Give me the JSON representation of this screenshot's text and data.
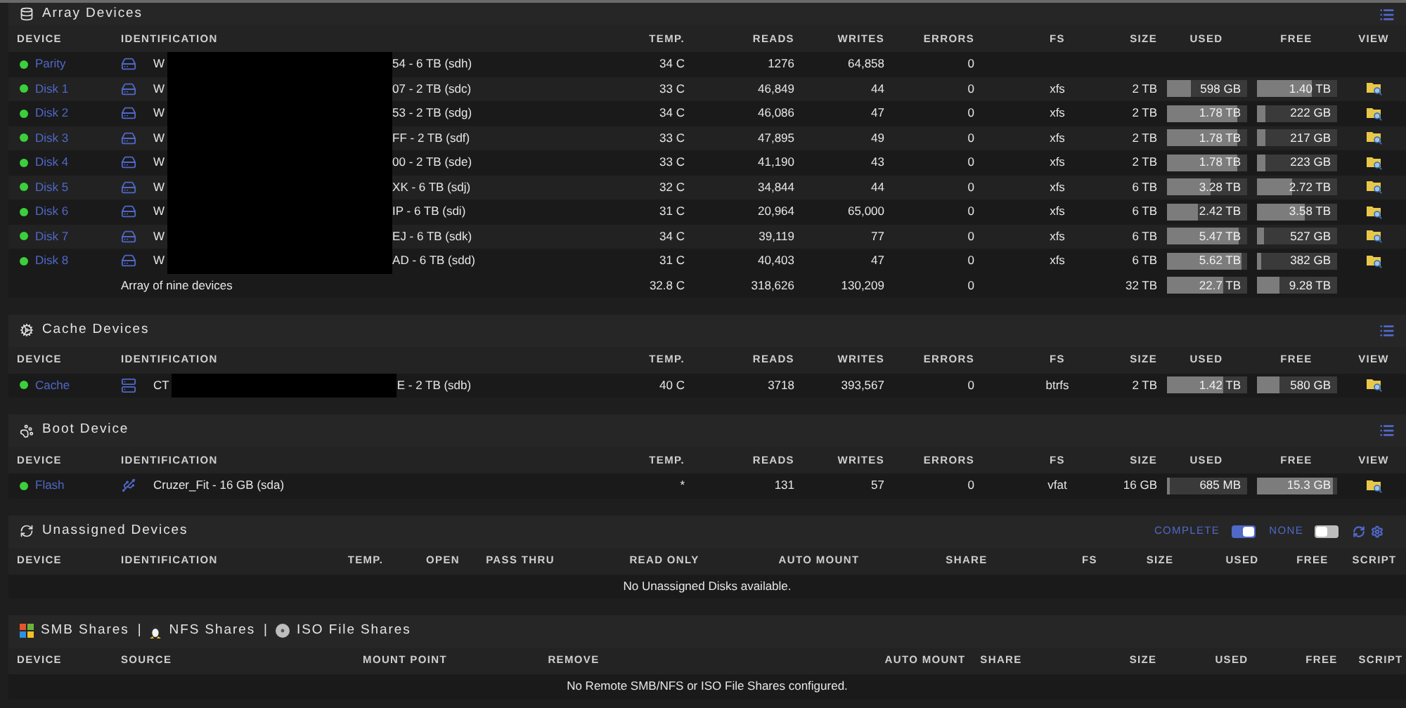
{
  "sections": [
    {
      "kind": "array",
      "title": "Array Devices",
      "columns": [
        "DEVICE",
        "IDENTIFICATION",
        "TEMP.",
        "READS",
        "WRITES",
        "ERRORS",
        "FS",
        "SIZE",
        "USED",
        "FREE",
        "VIEW"
      ],
      "rows": [
        {
          "device": "Parity",
          "id_start": "W",
          "redacted": true,
          "id_end": "54 - 6 TB (sdh)",
          "temp": "34 C",
          "reads": "1276",
          "writes": "64,858",
          "errors": "0"
        },
        {
          "device": "Disk 1",
          "id_start": "W",
          "redacted": true,
          "id_end": "07 - 2 TB (sdc)",
          "temp": "33 C",
          "reads": "46,849",
          "writes": "44",
          "errors": "0",
          "fs": "xfs",
          "size": "2 TB",
          "used": {
            "text": "598 GB",
            "level": 0.3
          },
          "free": {
            "text": "1.40 TB",
            "level": 0.7
          },
          "view": true
        },
        {
          "device": "Disk 2",
          "id_start": "W",
          "redacted": true,
          "id_end": "53 - 2 TB (sdg)",
          "temp": "34 C",
          "reads": "46,086",
          "writes": "47",
          "errors": "0",
          "fs": "xfs",
          "size": "2 TB",
          "used": {
            "text": "1.78 TB",
            "level": 0.89
          },
          "free": {
            "text": "222 GB",
            "level": 0.11
          },
          "view": true
        },
        {
          "device": "Disk 3",
          "id_start": "W",
          "redacted": true,
          "id_end": "FF - 2 TB (sdf)",
          "temp": "33 C",
          "reads": "47,895",
          "writes": "49",
          "errors": "0",
          "fs": "xfs",
          "size": "2 TB",
          "used": {
            "text": "1.78 TB",
            "level": 0.89
          },
          "free": {
            "text": "217 GB",
            "level": 0.11
          },
          "view": true
        },
        {
          "device": "Disk 4",
          "id_start": "W",
          "redacted": true,
          "id_end": "00 - 2 TB (sde)",
          "temp": "33 C",
          "reads": "41,190",
          "writes": "43",
          "errors": "0",
          "fs": "xfs",
          "size": "2 TB",
          "used": {
            "text": "1.78 TB",
            "level": 0.89
          },
          "free": {
            "text": "223 GB",
            "level": 0.11
          },
          "view": true
        },
        {
          "device": "Disk 5",
          "id_start": "W",
          "redacted": true,
          "id_end": "XK - 6 TB (sdj)",
          "temp": "32 C",
          "reads": "34,844",
          "writes": "44",
          "errors": "0",
          "fs": "xfs",
          "size": "6 TB",
          "used": {
            "text": "3.28 TB",
            "level": 0.55
          },
          "free": {
            "text": "2.72 TB",
            "level": 0.45
          },
          "view": true
        },
        {
          "device": "Disk 6",
          "id_start": "W",
          "redacted": true,
          "id_end": "IP - 6 TB (sdi)",
          "temp": "31 C",
          "reads": "20,964",
          "writes": "65,000",
          "errors": "0",
          "fs": "xfs",
          "size": "6 TB",
          "used": {
            "text": "2.42 TB",
            "level": 0.4
          },
          "free": {
            "text": "3.58 TB",
            "level": 0.6
          },
          "view": true
        },
        {
          "device": "Disk 7",
          "id_start": "W",
          "redacted": true,
          "id_end": "EJ - 6 TB (sdk)",
          "temp": "34 C",
          "reads": "39,119",
          "writes": "77",
          "errors": "0",
          "fs": "xfs",
          "size": "6 TB",
          "used": {
            "text": "5.47 TB",
            "level": 0.91
          },
          "free": {
            "text": "527 GB",
            "level": 0.09
          },
          "view": true
        },
        {
          "device": "Disk 8",
          "id_start": "W",
          "redacted": true,
          "id_end": "AD - 6 TB (sdd)",
          "temp": "31 C",
          "reads": "40,403",
          "writes": "47",
          "errors": "0",
          "fs": "xfs",
          "size": "6 TB",
          "used": {
            "text": "5.62 TB",
            "level": 0.94
          },
          "free": {
            "text": "382 GB",
            "level": 0.06
          },
          "view": true
        }
      ],
      "total": {
        "label": "Array of nine devices",
        "temp": "32.8 C",
        "reads": "318,626",
        "writes": "130,209",
        "errors": "0",
        "size": "32 TB",
        "used": {
          "text": "22.7 TB",
          "level": 0.71
        },
        "free": {
          "text": "9.28 TB",
          "level": 0.29
        }
      }
    },
    {
      "kind": "cache",
      "title": "Cache Devices",
      "columns": [
        "DEVICE",
        "IDENTIFICATION",
        "TEMP.",
        "READS",
        "WRITES",
        "ERRORS",
        "FS",
        "SIZE",
        "USED",
        "FREE",
        "VIEW"
      ],
      "rows": [
        {
          "device": "Cache",
          "id_start": "CT",
          "redacted": true,
          "id_end": "E - 2 TB (sdb)",
          "temp": "40 C",
          "reads": "3718",
          "writes": "393,567",
          "errors": "0",
          "fs": "btrfs",
          "size": "2 TB",
          "used": {
            "text": "1.42 TB",
            "level": 0.71
          },
          "free": {
            "text": "580 GB",
            "level": 0.29
          },
          "view": true
        }
      ]
    },
    {
      "kind": "boot",
      "title": "Boot Device",
      "columns": [
        "DEVICE",
        "IDENTIFICATION",
        "TEMP.",
        "READS",
        "WRITES",
        "ERRORS",
        "FS",
        "SIZE",
        "USED",
        "FREE",
        "VIEW"
      ],
      "rows": [
        {
          "device": "Flash",
          "id_start": "Cruzer_Fit",
          "redacted": false,
          "id_end": " - 16 GB (sda)",
          "temp": "*",
          "reads": "131",
          "writes": "57",
          "errors": "0",
          "fs": "vfat",
          "size": "16 GB",
          "used": {
            "text": "685 MB",
            "level": 0.04
          },
          "free": {
            "text": "15.3 GB",
            "level": 0.96
          },
          "view": true
        }
      ]
    },
    {
      "kind": "unassigned",
      "title": "Unassigned Devices",
      "toggles": [
        {
          "label": "COMPLETE",
          "on": true
        },
        {
          "label": "NONE",
          "on": false
        }
      ],
      "columns": [
        "DEVICE",
        "IDENTIFICATION",
        "TEMP.",
        "OPEN",
        "PASS THRU",
        "READ ONLY",
        "AUTO MOUNT",
        "SHARE",
        "FS",
        "SIZE",
        "USED",
        "FREE",
        "SCRIPT"
      ],
      "message": "No Unassigned Disks available."
    },
    {
      "kind": "shares",
      "tabs": [
        {
          "label": "SMB Shares"
        },
        {
          "separator": "|",
          "label": "NFS Shares"
        },
        {
          "separator": "|",
          "label": "ISO File Shares"
        }
      ],
      "columns": [
        "DEVICE",
        "SOURCE",
        "MOUNT POINT",
        "REMOVE",
        "AUTO MOUNT",
        "SHARE",
        "SIZE",
        "USED",
        "FREE",
        "SCRIPT"
      ],
      "message": "No Remote SMB/NFS or ISO File Shares configured."
    }
  ]
}
